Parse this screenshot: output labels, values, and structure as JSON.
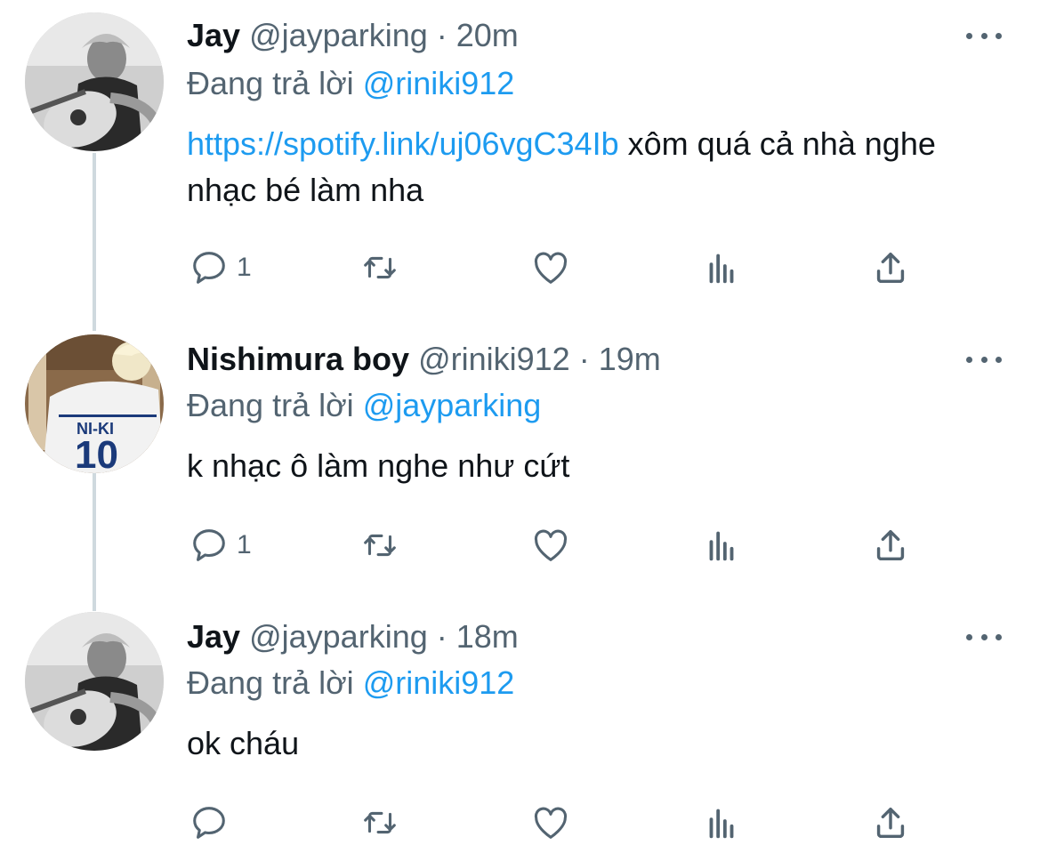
{
  "tweets": [
    {
      "name": "Jay",
      "handle": "@jayparking",
      "dot": "·",
      "time": "20m",
      "reply_prefix": "Đang trả lời ",
      "reply_to": "@riniki912",
      "link": "https://spotify.link/uj06vgC34Ib",
      "text": " xôm quá cả nhà nghe nhạc bé làm nha",
      "reply_count": "1"
    },
    {
      "name": "Nishimura boy",
      "handle": "@riniki912",
      "dot": "·",
      "time": "19m",
      "reply_prefix": "Đang trả lời ",
      "reply_to": "@jayparking",
      "link": "",
      "text": "k nhạc ô làm nghe như cứt",
      "reply_count": "1"
    },
    {
      "name": "Jay",
      "handle": "@jayparking",
      "dot": "·",
      "time": "18m",
      "reply_prefix": "Đang trả lời ",
      "reply_to": "@riniki912",
      "link": "",
      "text": "ok cháu",
      "reply_count": ""
    }
  ],
  "avatar_lettering": {
    "jersey_name": "NI-KI",
    "jersey_number": "10"
  },
  "icons": [
    "reply-icon",
    "retweet-icon",
    "like-icon",
    "analytics-icon",
    "share-icon",
    "more-icon"
  ],
  "colors": {
    "link": "#1d9bf0",
    "secondary": "#536471",
    "text": "#0f1419",
    "thread_line": "#cfd9de"
  }
}
